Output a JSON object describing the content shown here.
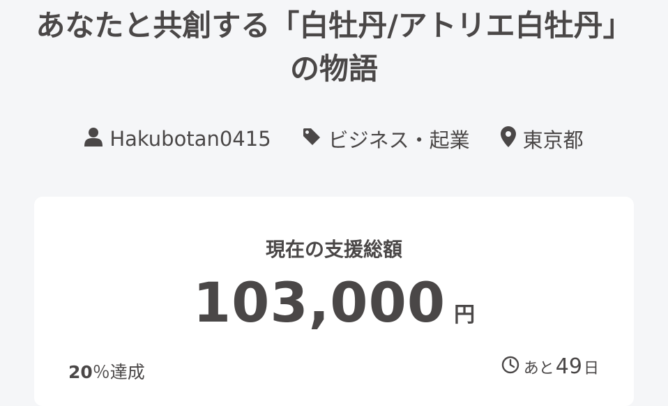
{
  "project": {
    "title": "あなたと共創する「白牡丹/アトリエ白牡丹」の物語"
  },
  "meta": {
    "owner": {
      "icon": "user-icon",
      "label": "Hakubotan0415"
    },
    "category": {
      "icon": "tag-icon",
      "label": "ビジネス・起業"
    },
    "location": {
      "icon": "location-pin-icon",
      "label": "東京都"
    }
  },
  "funding": {
    "label": "現在の支援総額",
    "amount": "103,000",
    "unit": "円",
    "progress_percent": "20",
    "progress_suffix": "％達成",
    "remaining_prefix": "あと",
    "remaining_days": "49",
    "remaining_suffix": "日",
    "clock_icon": "clock-icon"
  }
}
